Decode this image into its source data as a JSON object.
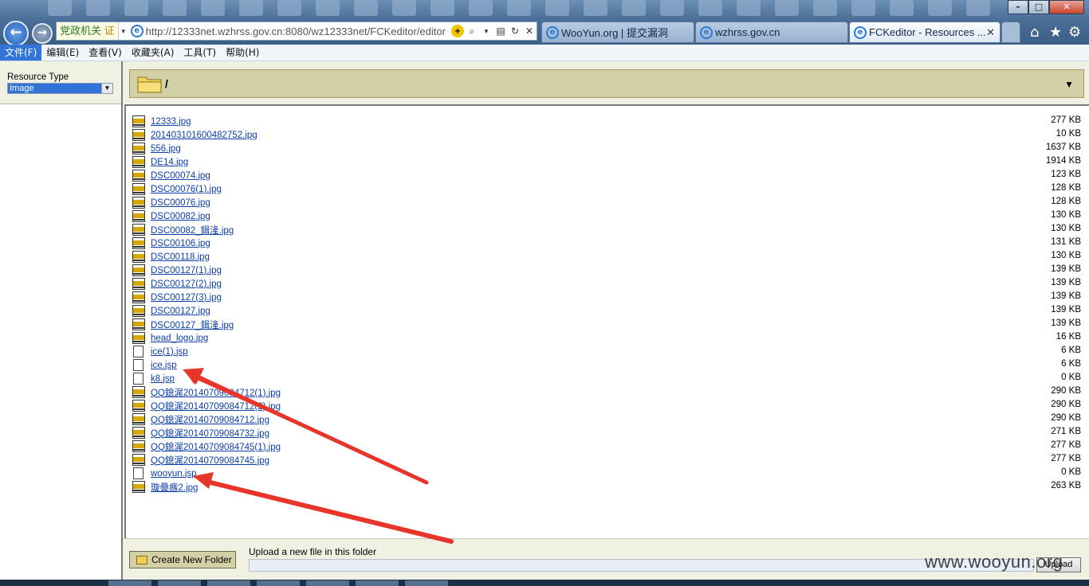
{
  "browser": {
    "zone_label": "党政机关",
    "zone_badge": "证",
    "url": "http://12333net.wzhrss.gov.cn:8080/wz12333net/FCKeditor/editor",
    "tabs": [
      {
        "label": "WooYun.org | 提交漏洞",
        "active": false
      },
      {
        "label": "wzhrss.gov.cn",
        "active": false
      },
      {
        "label": "FCKeditor - Resources ...",
        "active": true
      }
    ],
    "menu": [
      "文件(F)",
      "编辑(E)",
      "查看(V)",
      "收藏夹(A)",
      "工具(T)",
      "帮助(H)"
    ]
  },
  "resource_type": {
    "label": "Resource Type",
    "selected": "Image"
  },
  "current_path": "/",
  "files": [
    {
      "name": "12333.jpg",
      "size": "277 KB",
      "type": "jpg"
    },
    {
      "name": "201403101600482752.jpg",
      "size": "10 KB",
      "type": "jpg"
    },
    {
      "name": "556.jpg",
      "size": "1637 KB",
      "type": "jpg"
    },
    {
      "name": "DE14.jpg",
      "size": "1914 KB",
      "type": "jpg"
    },
    {
      "name": "DSC00074.jpg",
      "size": "123 KB",
      "type": "jpg"
    },
    {
      "name": "DSC00076(1).jpg",
      "size": "128 KB",
      "type": "jpg"
    },
    {
      "name": "DSC00076.jpg",
      "size": "128 KB",
      "type": "jpg"
    },
    {
      "name": "DSC00082.jpg",
      "size": "130 KB",
      "type": "jpg"
    },
    {
      "name": "DSC00082_鍓湰.jpg",
      "size": "130 KB",
      "type": "jpg"
    },
    {
      "name": "DSC00106.jpg",
      "size": "131 KB",
      "type": "jpg"
    },
    {
      "name": "DSC00118.jpg",
      "size": "130 KB",
      "type": "jpg"
    },
    {
      "name": "DSC00127(1).jpg",
      "size": "139 KB",
      "type": "jpg"
    },
    {
      "name": "DSC00127(2).jpg",
      "size": "139 KB",
      "type": "jpg"
    },
    {
      "name": "DSC00127(3).jpg",
      "size": "139 KB",
      "type": "jpg"
    },
    {
      "name": "DSC00127.jpg",
      "size": "139 KB",
      "type": "jpg"
    },
    {
      "name": "DSC00127_鍓湰.jpg",
      "size": "139 KB",
      "type": "jpg"
    },
    {
      "name": "head_logo.jpg",
      "size": "16 KB",
      "type": "jpg"
    },
    {
      "name": "ice(1).jsp",
      "size": "6 KB",
      "type": "doc"
    },
    {
      "name": "ice.jsp",
      "size": "6 KB",
      "type": "doc"
    },
    {
      "name": "k8.jsp",
      "size": "0 KB",
      "type": "doc"
    },
    {
      "name": "QQ鎴浘20140709084712(1).jpg",
      "size": "290 KB",
      "type": "jpg"
    },
    {
      "name": "QQ鎴浘20140709084712(2).jpg",
      "size": "290 KB",
      "type": "jpg"
    },
    {
      "name": "QQ鎴浘20140709084712.jpg",
      "size": "290 KB",
      "type": "jpg"
    },
    {
      "name": "QQ鎴浘20140709084732.jpg",
      "size": "271 KB",
      "type": "jpg"
    },
    {
      "name": "QQ鎴浘20140709084745(1).jpg",
      "size": "277 KB",
      "type": "jpg"
    },
    {
      "name": "QQ鎴浘20140709084745.jpg",
      "size": "277 KB",
      "type": "jpg"
    },
    {
      "name": "wooyun.jsp",
      "size": "0 KB",
      "type": "doc"
    },
    {
      "name": "璇曡瘯2.jpg",
      "size": "263 KB",
      "type": "jpg"
    }
  ],
  "bottom": {
    "create_folder": "Create New Folder",
    "upload_label": "Upload a new file in this folder",
    "upload_button": "Upload"
  },
  "watermark": "www.wooyun.org",
  "colors": {
    "annotation_arrow": "#e8352b",
    "panel_bg": "#f1f1e3",
    "path_bg": "#d3d0a6",
    "link": "#0b3ea8"
  }
}
